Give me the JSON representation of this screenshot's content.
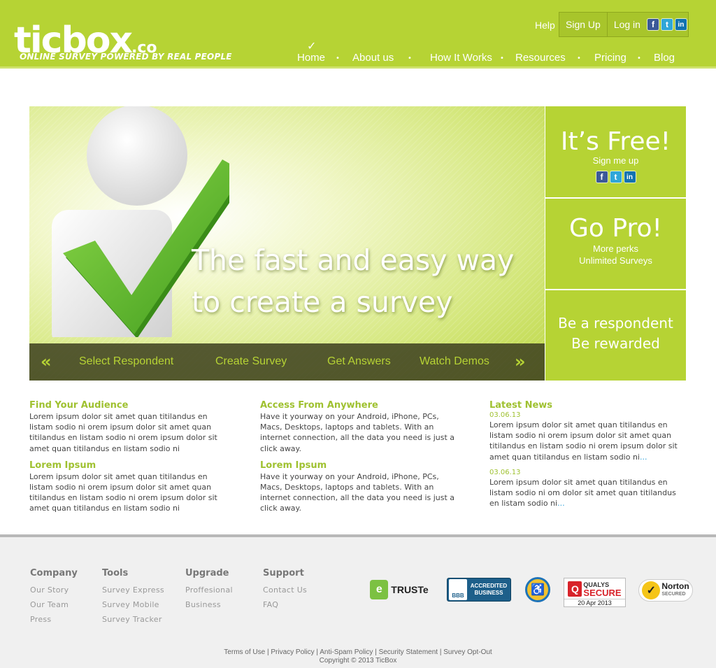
{
  "header": {
    "logo_text": "ticbox",
    "logo_suffix": ".co",
    "logo_tagline": "ONLINE SURVEY POWERED BY REAL PEOPLE",
    "help": "Help",
    "signup": "Sign Up",
    "login": "Log in",
    "social": [
      "f",
      "t",
      "in"
    ]
  },
  "nav": {
    "items": [
      "Home",
      "About us",
      "How It Works",
      "Resources",
      "Pricing",
      "Blog"
    ],
    "active": "Home",
    "separator": "•",
    "active_mark": "✓"
  },
  "hero": {
    "heading_line1": "The fast and easy way",
    "heading_line2": "to create a survey",
    "bar_left_arrow": "«",
    "bar_right_arrow": "»",
    "bar_links": [
      "Select Respondent",
      "Create Survey",
      "Get Answers",
      "Watch Demos"
    ]
  },
  "panels": {
    "free": {
      "title": "It’s Free!",
      "subtitle": "Sign me up"
    },
    "pro": {
      "title": "Go Pro!",
      "line1": "More perks",
      "line2": "Unlimited Surveys"
    },
    "respondent": {
      "line1": "Be a respondent",
      "line2": "Be rewarded"
    }
  },
  "content": {
    "col1": [
      {
        "title": "Find Your Audience",
        "text": "Lorem ipsum dolor sit amet quan titilandus en listam sodio ni orem ipsum dolor sit amet quan titilandus en listam sodio ni orem ipsum dolor sit amet quan titilandus en listam sodio ni"
      },
      {
        "title": "Lorem Ipsum",
        "text": "Lorem ipsum dolor sit amet quan titilandus en listam sodio ni orem ipsum dolor sit amet quan titilandus en listam sodio ni orem ipsum dolor sit amet quan titilandus en listam sodio ni"
      }
    ],
    "col2": [
      {
        "title": "Access From Anywhere",
        "text": "Have it yourway on your Android, iPhone, PCs, Macs, Desktops, laptops and tablets. With an internet connection, all the data you need is just a click away."
      },
      {
        "title": "Lorem Ipsum",
        "text": "Have it yourway on your Android, iPhone, PCs, Macs, Desktops, laptops and tablets. With an internet connection, all the data you need is just a click away."
      }
    ],
    "news": {
      "title": "Latest News",
      "items": [
        {
          "date": "03.06.13",
          "text": "Lorem ipsum dolor sit amet quan titilandus en listam sodio ni orem ipsum dolor sit amet quan titilandus en listam sodio ni orem ipsum dolor sit amet quan titilandus en listam sodio ni",
          "more": "..."
        },
        {
          "date": "03.06.13",
          "text": "Lorem ipsum dolor sit amet quan titilandus en listam sodio ni om dolor sit amet quan titilandus en listam sodio ni",
          "more": "..."
        }
      ]
    }
  },
  "footer": {
    "columns": [
      {
        "title": "Company",
        "links": [
          "Our Story",
          "Our Team",
          "Press"
        ]
      },
      {
        "title": "Tools",
        "links": [
          "Survey Express",
          "Survey Mobile",
          "Survey Tracker"
        ]
      },
      {
        "title": "Upgrade",
        "links": [
          "Proffesional",
          "Business"
        ]
      },
      {
        "title": "Support",
        "links": [
          "Contact Us",
          "FAQ"
        ]
      }
    ],
    "badges": {
      "truste": "TRUSTe",
      "bbb_label": "BBB",
      "bbb_line1": "ACCREDITED",
      "bbb_line2": "BUSINESS",
      "qualys_top": "QUALYS",
      "qualys_main": "SECURE",
      "qualys_date": "20 Apr 2013",
      "norton": "Norton",
      "norton_sub": "SECURED"
    },
    "legal_links": [
      "Terms of Use",
      "Privacy Policy",
      "Anti-Spam Policy",
      "Security Statement",
      "Survey Opt-Out"
    ],
    "legal_sep": "|",
    "copyright": "Copyright © 2013 TicBox"
  },
  "colors": {
    "brand_green": "#b6d334",
    "heading_green": "#9fc130",
    "link_blue": "#2a9fd8"
  }
}
